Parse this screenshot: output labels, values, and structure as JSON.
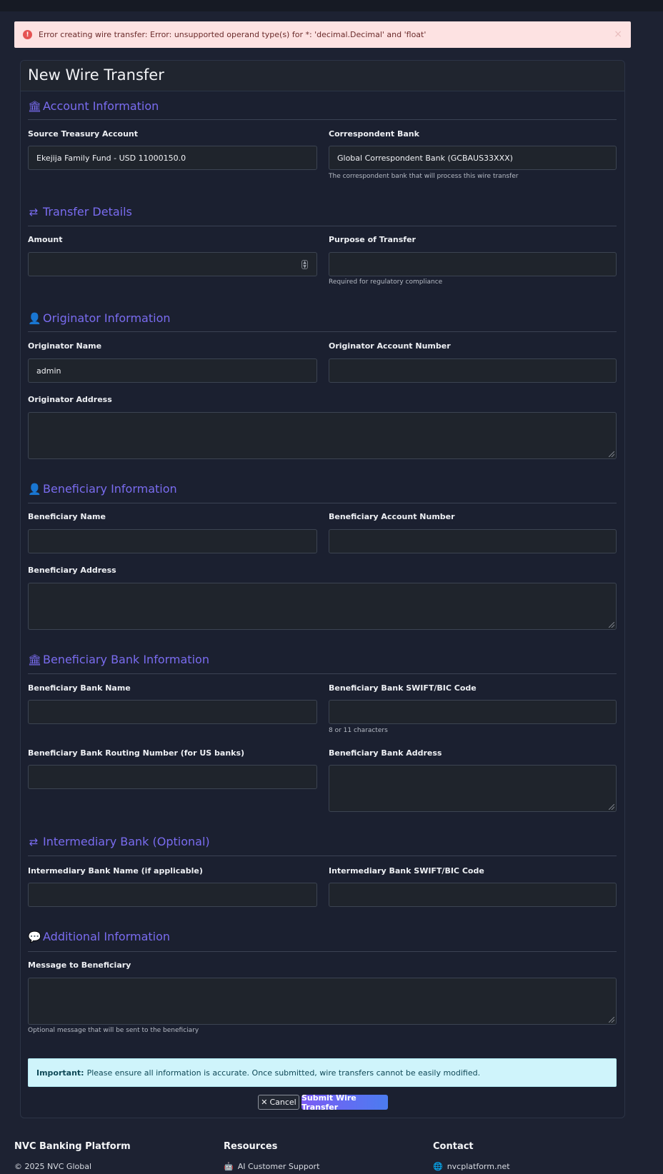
{
  "alert": {
    "message": "Error creating wire transfer: Error: unsupported operand type(s) for *: 'decimal.Decimal' and 'float'",
    "icon": "error-icon",
    "close": "×"
  },
  "header": {
    "title": "New Wire Transfer"
  },
  "sections": {
    "account": {
      "title": "Account Information",
      "icon": "bank-icon"
    },
    "transfer": {
      "title": "Transfer Details",
      "icon": "transfer-icon"
    },
    "originator": {
      "title": "Originator Information",
      "icon": "user-icon"
    },
    "beneficiary": {
      "title": "Beneficiary Information",
      "icon": "add-user-icon"
    },
    "beneficiary_bank": {
      "title": "Beneficiary Bank Information",
      "icon": "bank-icon"
    },
    "intermediary": {
      "title": "Intermediary Bank (Optional)",
      "icon": "transfer-icon"
    },
    "additional": {
      "title": "Additional Information",
      "icon": "chat-icon"
    }
  },
  "fields": {
    "source_account": {
      "label": "Source Treasury Account",
      "value": "Ekejija Family Fund - USD 11000150.0"
    },
    "correspondent_bank": {
      "label": "Correspondent Bank",
      "value": "Global Correspondent Bank (GCBAUS33XXX)",
      "hint": "The correspondent bank that will process this wire transfer"
    },
    "amount": {
      "label": "Amount",
      "value": ""
    },
    "purpose": {
      "label": "Purpose of Transfer",
      "value": "",
      "hint": "Required for regulatory compliance"
    },
    "originator_name": {
      "label": "Originator Name",
      "value": "admin"
    },
    "originator_account": {
      "label": "Originator Account Number",
      "value": ""
    },
    "originator_address": {
      "label": "Originator Address",
      "value": ""
    },
    "beneficiary_name": {
      "label": "Beneficiary Name",
      "value": ""
    },
    "beneficiary_account": {
      "label": "Beneficiary Account Number",
      "value": ""
    },
    "beneficiary_address": {
      "label": "Beneficiary Address",
      "value": ""
    },
    "beneficiary_bank_name": {
      "label": "Beneficiary Bank Name",
      "value": ""
    },
    "beneficiary_bank_swift": {
      "label": "Beneficiary Bank SWIFT/BIC Code",
      "value": "",
      "hint": "8 or 11 characters"
    },
    "beneficiary_bank_routing": {
      "label": "Beneficiary Bank Routing Number (for US banks)",
      "value": ""
    },
    "beneficiary_bank_address": {
      "label": "Beneficiary Bank Address",
      "value": ""
    },
    "intermediary_bank_name": {
      "label": "Intermediary Bank Name (if applicable)",
      "value": ""
    },
    "intermediary_bank_swift": {
      "label": "Intermediary Bank SWIFT/BIC Code",
      "value": ""
    },
    "message": {
      "label": "Message to Beneficiary",
      "value": "",
      "hint": "Optional message that will be sent to the beneficiary"
    }
  },
  "notice": {
    "strong": "Important:",
    "text": "Please ensure all information is accurate. Once submitted, wire transfers cannot be easily modified."
  },
  "buttons": {
    "cancel": "Cancel",
    "cancel_icon": "✕",
    "submit": "Submit Wire Transfer"
  },
  "footer": {
    "brand": "NVC Banking Platform",
    "copyright": "© 2025 NVC Global",
    "resources_title": "Resources",
    "resources_link": "AI Customer Support",
    "contact_title": "Contact",
    "contact_link": "nvcplatform.net"
  },
  "colors": {
    "accent": "#7a6cf0",
    "background": "#1d2232",
    "alert_bg": "#fde2e2",
    "notice_bg": "#cff4fb"
  }
}
